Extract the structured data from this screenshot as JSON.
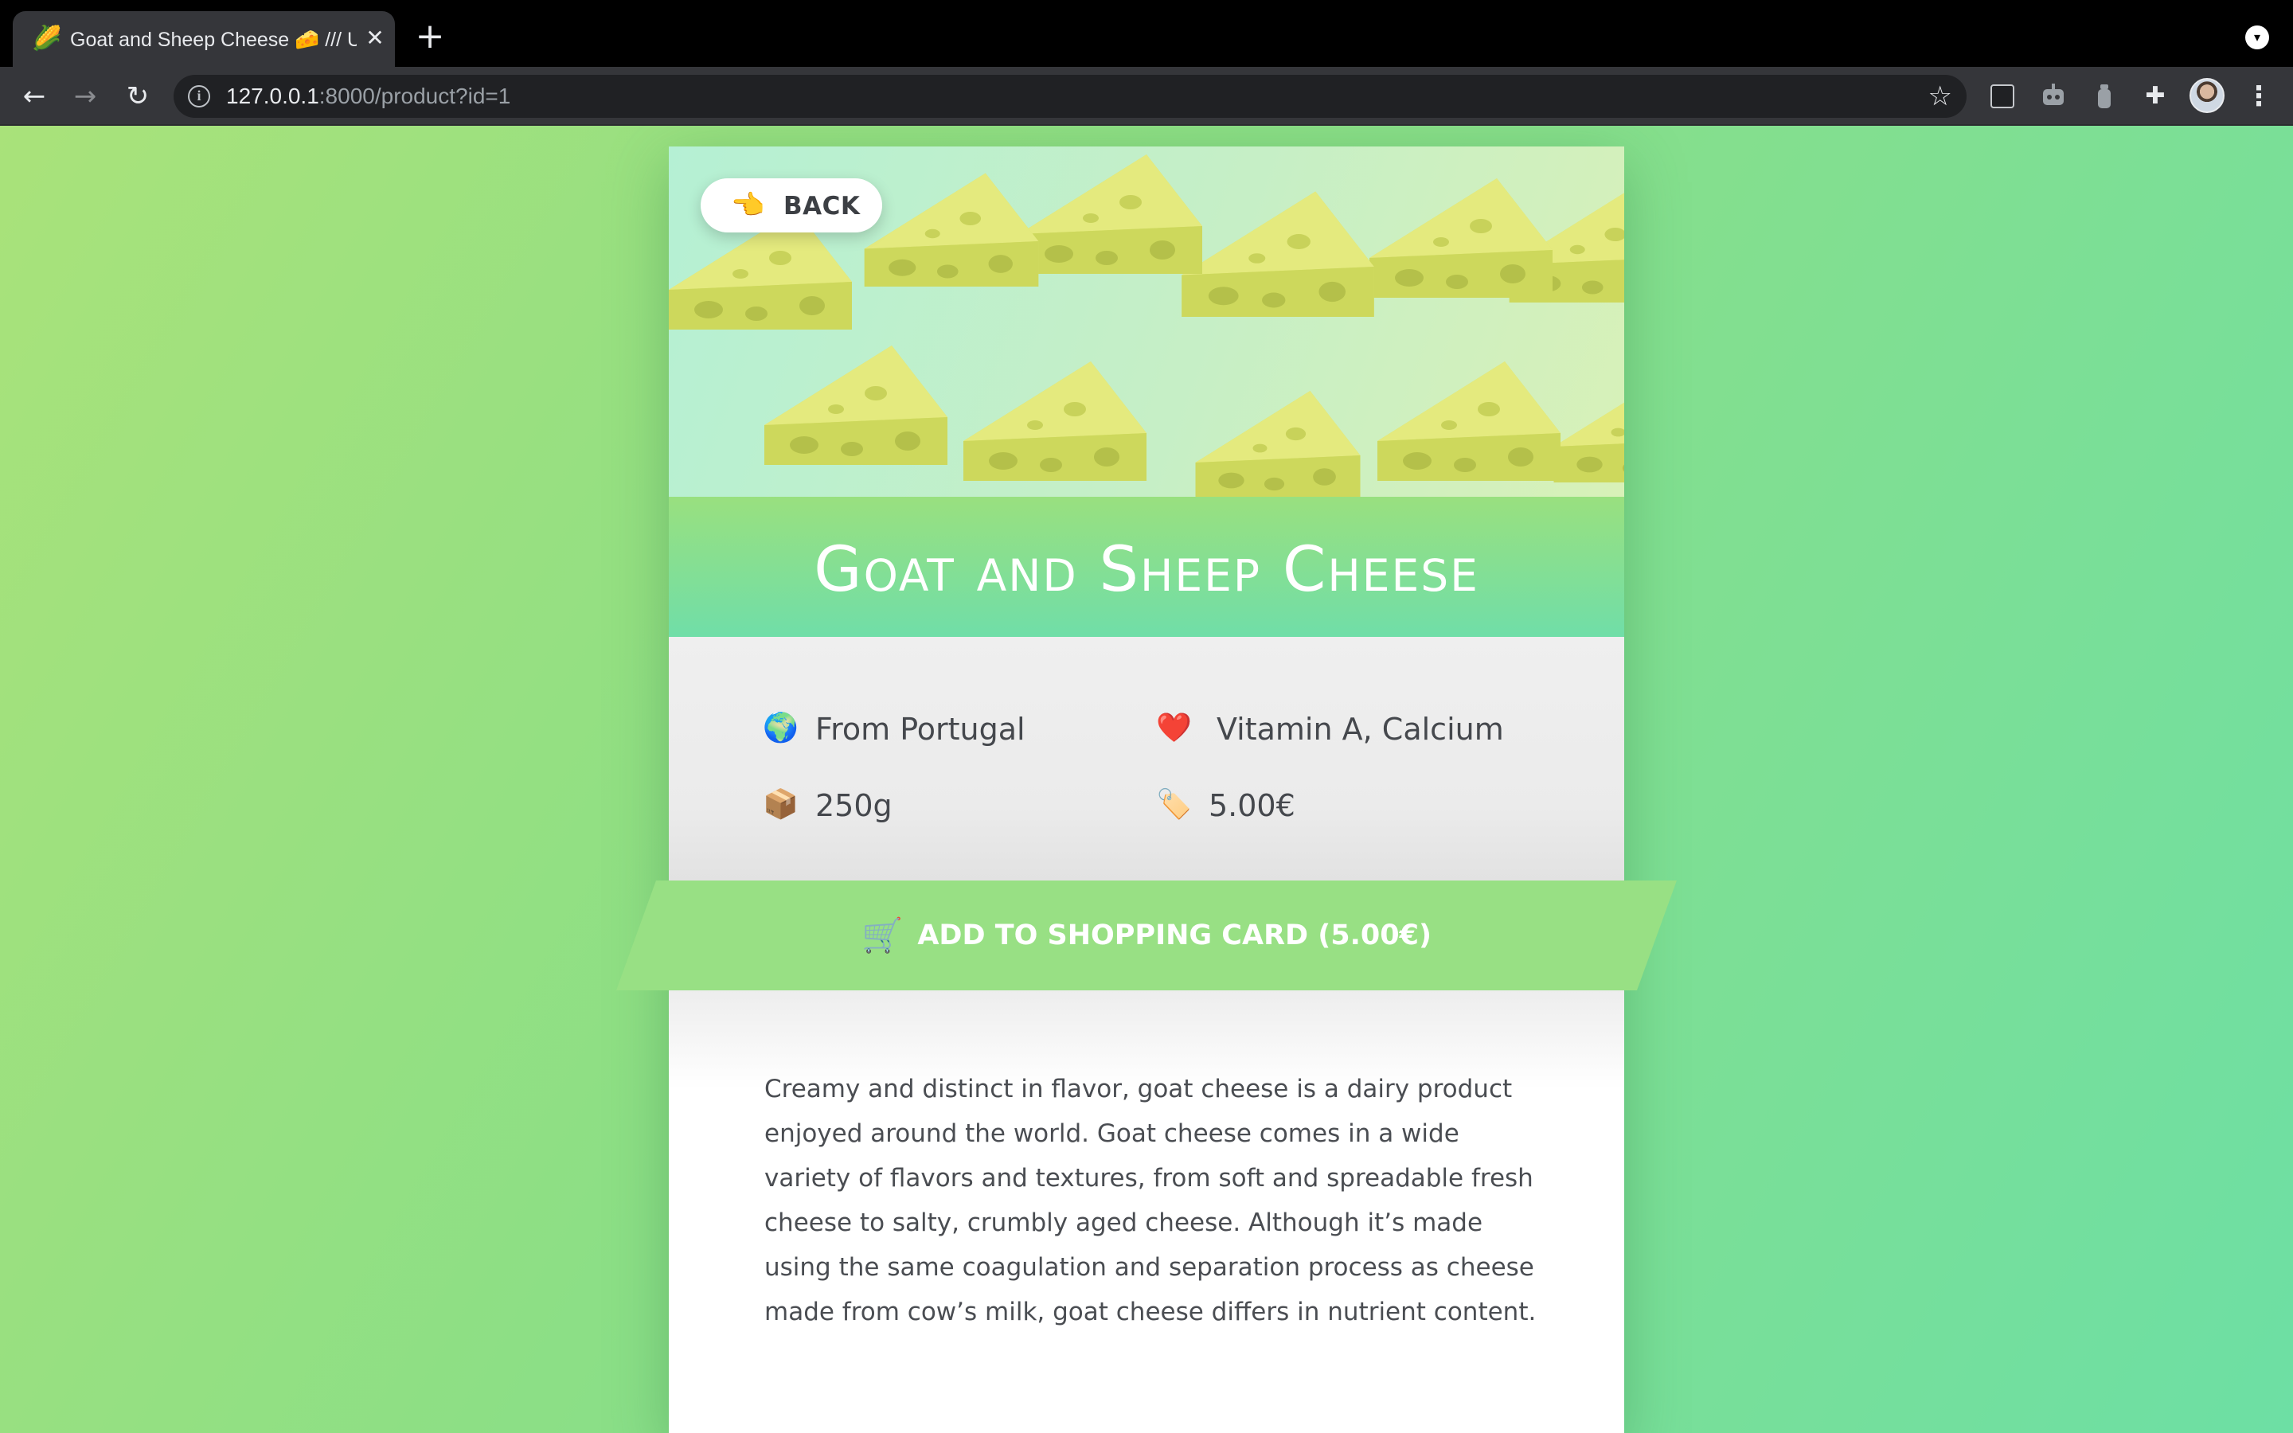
{
  "browser": {
    "tab": {
      "favicon": "🌽",
      "title": "Goat and Sheep Cheese 🧀 /// Ur",
      "close": "✕"
    },
    "new_tab": "+",
    "tab_menu": "▾",
    "nav": {
      "back": "←",
      "forward": "→",
      "reload": "↻"
    },
    "address": {
      "info": "i",
      "host": "127.0.0.1",
      "rest": ":8000/product?id=1",
      "bookmark": "☆"
    },
    "extensions": [
      "terminal-extension-icon",
      "robot-extension-icon",
      "bottle-extension-icon",
      "puzzle-extensions-icon"
    ],
    "puzzle": "✚",
    "menu": "⋮"
  },
  "product": {
    "back_icon": "👈",
    "back_label": "BACK",
    "title": "Goat and Sheep Cheese",
    "details": {
      "origin_icon": "🌍",
      "origin": "From Portugal",
      "nutrients_icon": "❤️",
      "nutrients": "Vitamin A, Calcium",
      "weight_icon": "📦",
      "weight": "250g",
      "price_icon": "🏷️",
      "price": "5.00€"
    },
    "cart_icon": "🛒",
    "cart_label": "ADD TO SHOPPING CARD (5.00€)",
    "description": "Creamy and distinct in flavor, goat cheese is a dairy product enjoyed around the world. Goat cheese comes in a wide variety of flavors and textures, from soft and spreadable fresh cheese to salty, crumbly aged cheese. Although it’s made using the same coagulation and separation process as cheese made from cow’s milk, goat cheese differs in nutrient content."
  },
  "colors": {
    "page_gradient_start": "#a9e27a",
    "page_gradient_end": "#6ddfa4",
    "cart_button": "#98e084",
    "title_band_top": "#99e07f",
    "title_band_bottom": "#70dea8"
  }
}
